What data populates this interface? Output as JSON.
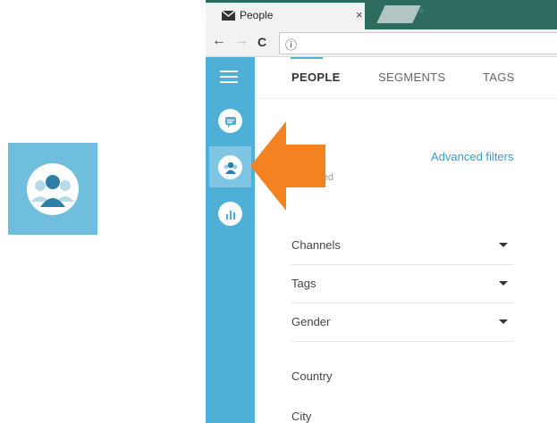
{
  "browser": {
    "tab_title": "People",
    "tab_close": "×",
    "nav": {
      "back": "←",
      "forward": "→",
      "reload": "C",
      "info": "ⓘ"
    }
  },
  "app": {
    "tabs": [
      {
        "label": "PEOPLE",
        "active": true
      },
      {
        "label": "SEGMENTS",
        "active": false
      },
      {
        "label": "TAGS",
        "active": false
      }
    ],
    "filters": {
      "title_fragment": "s",
      "subtitle_fragment": "s applied",
      "advanced_link": "Advanced filters",
      "dropdowns": [
        {
          "label": "Channels"
        },
        {
          "label": "Tags"
        },
        {
          "label": "Gender"
        }
      ],
      "plain": [
        {
          "label": "Country"
        },
        {
          "label": "City"
        }
      ]
    },
    "sidebar_icons": [
      "menu-icon",
      "chat-icon",
      "people-icon",
      "bar-chart-icon"
    ]
  },
  "colors": {
    "sidebar": "#4eb0d6",
    "highlight_box": "#6fbedd",
    "accent_link": "#3b9ccc",
    "arrow": "#f58220",
    "tabstrip": "#2c6b5e"
  }
}
